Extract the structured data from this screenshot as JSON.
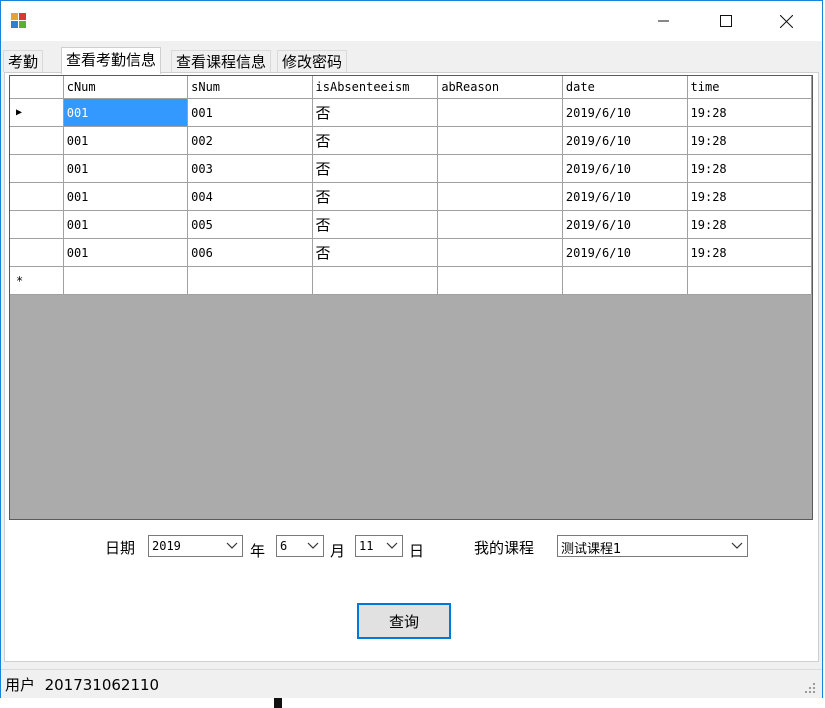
{
  "window": {
    "minimize_symbol": "—",
    "maximize_symbol": "☐",
    "close_symbol": "✕"
  },
  "tabs": [
    "考勤",
    "查看考勤信息",
    "查看课程信息",
    "修改密码"
  ],
  "active_tab_index": 1,
  "grid": {
    "columns": [
      "cNum",
      "sNum",
      "isAbsenteeism",
      "abReason",
      "date",
      "time"
    ],
    "rows": [
      {
        "marker": "▶",
        "cNum": "001",
        "sNum": "001",
        "isAbsenteeism": "否",
        "abReason": "",
        "date": "2019/6/10",
        "time": "19:28"
      },
      {
        "marker": "",
        "cNum": "001",
        "sNum": "002",
        "isAbsenteeism": "否",
        "abReason": "",
        "date": "2019/6/10",
        "time": "19:28"
      },
      {
        "marker": "",
        "cNum": "001",
        "sNum": "003",
        "isAbsenteeism": "否",
        "abReason": "",
        "date": "2019/6/10",
        "time": "19:28"
      },
      {
        "marker": "",
        "cNum": "001",
        "sNum": "004",
        "isAbsenteeism": "否",
        "abReason": "",
        "date": "2019/6/10",
        "time": "19:28"
      },
      {
        "marker": "",
        "cNum": "001",
        "sNum": "005",
        "isAbsenteeism": "否",
        "abReason": "",
        "date": "2019/6/10",
        "time": "19:28"
      },
      {
        "marker": "",
        "cNum": "001",
        "sNum": "006",
        "isAbsenteeism": "否",
        "abReason": "",
        "date": "2019/6/10",
        "time": "19:28"
      }
    ],
    "new_row_marker": "*",
    "selected_cell": {
      "row": 0,
      "column": "cNum"
    }
  },
  "filters": {
    "date_label": "日期",
    "year_value": "2019",
    "year_label": "年",
    "month_value": "6",
    "month_label": "月",
    "day_value": "11",
    "day_label": "日",
    "course_label": "我的课程",
    "course_value": "测试课程1"
  },
  "query_button": "查询",
  "status": {
    "user_label": "用户",
    "user_id": "201731062110"
  },
  "colors": {
    "accent": "#0078d7",
    "selection": "#3399ff",
    "grid_background": "#ababab"
  }
}
